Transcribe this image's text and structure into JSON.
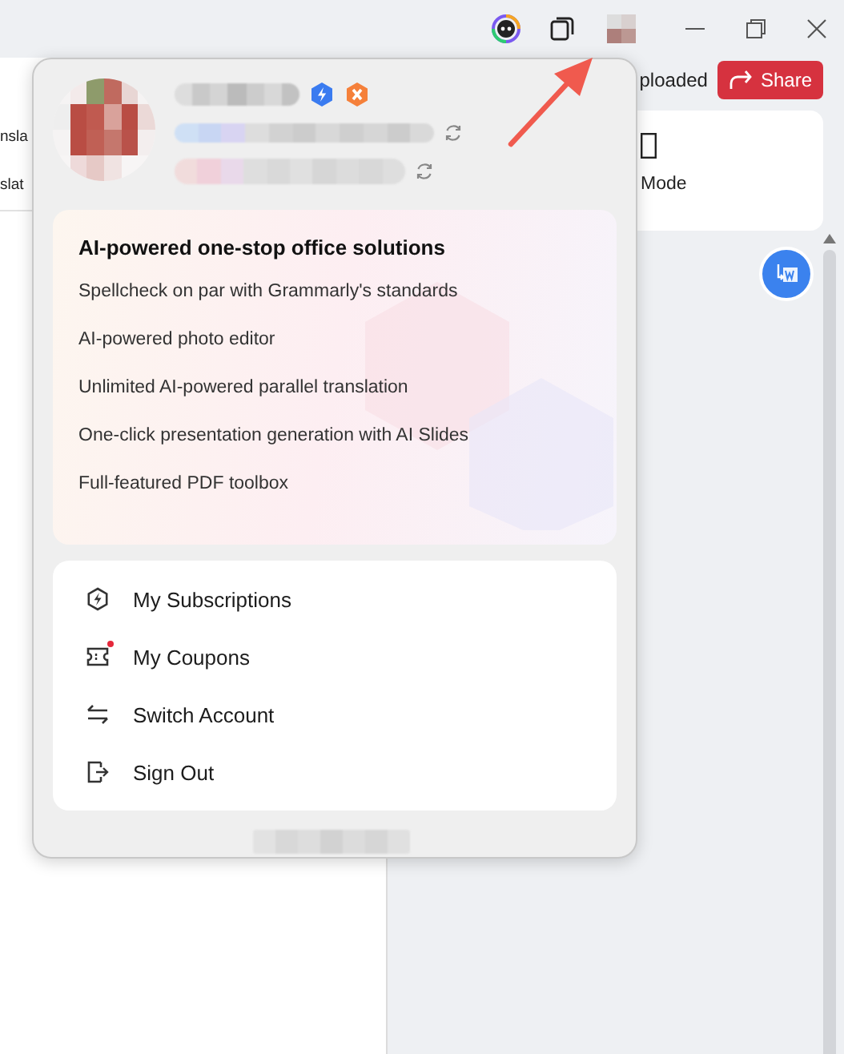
{
  "left_panel": {
    "texts": [
      "nsla",
      "slat"
    ]
  },
  "header": {
    "upload_status": "ploaded",
    "share_button": "Share"
  },
  "right_card": {
    "label": "Mode"
  },
  "account_popup": {
    "promo": {
      "title": "AI-powered one-stop office solutions",
      "features": [
        "Spellcheck on par with Grammarly's standards",
        "AI-powered photo editor",
        "Unlimited AI-powered parallel translation",
        "One-click presentation generation with AI Slides",
        "Full-featured PDF toolbox"
      ]
    },
    "menu": [
      {
        "kind": "subscriptions",
        "label": "My Subscriptions",
        "notification": false
      },
      {
        "kind": "coupons",
        "label": "My Coupons",
        "notification": true
      },
      {
        "kind": "switch",
        "label": "Switch Account",
        "notification": false
      },
      {
        "kind": "signout",
        "label": "Sign Out",
        "notification": false
      }
    ]
  }
}
